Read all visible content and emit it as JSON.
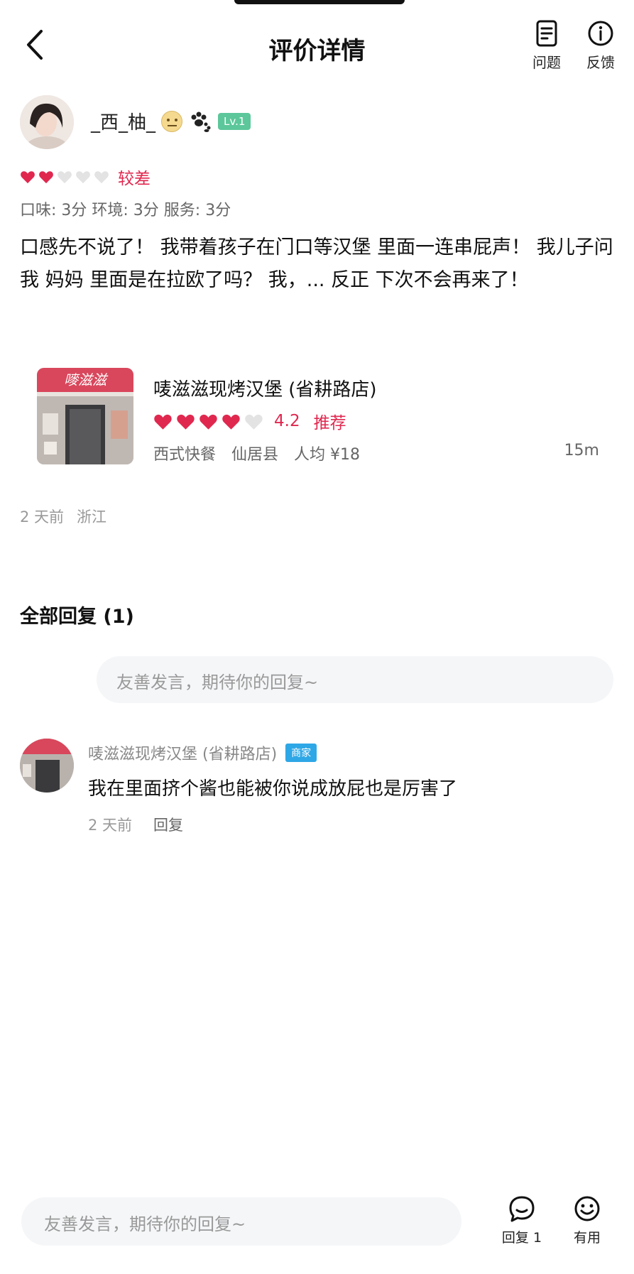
{
  "header": {
    "title": "评价详情",
    "question_label": "问题",
    "feedback_label": "反馈"
  },
  "user": {
    "name": "_西_柚_",
    "level": "Lv.1"
  },
  "rating": {
    "hearts_filled": 2,
    "hearts_total": 5,
    "label": "较差",
    "scores": "口味: 3分  环境: 3分  服务: 3分"
  },
  "review": {
    "text": "口感先不说了！ 我带着孩子在门口等汉堡  里面一连串屁声！ 我儿子问我 妈妈 里面是在拉欧了吗？ 我，... 反正 下次不会再来了！"
  },
  "shop": {
    "sign_text": "嘜滋滋",
    "name": "唛滋滋现烤汉堡 (省耕路店)",
    "hearts_filled": 4,
    "hearts_total": 5,
    "score": "4.2",
    "recommend": "推荐",
    "category": "西式快餐",
    "area": "仙居县",
    "avg_price": "人均 ¥18",
    "distance": "15m"
  },
  "post_meta": {
    "time": "2 天前",
    "location": "浙江"
  },
  "replies": {
    "title": "全部回复 (1)",
    "input_placeholder": "友善发言，期待你的回复~",
    "items": [
      {
        "name": "唛滋滋现烤汉堡 (省耕路店)",
        "badge": "商家",
        "text": "我在里面挤个酱也能被你说成放屁也是厉害了",
        "time": "2 天前",
        "reply_label": "回复"
      }
    ]
  },
  "bottom_bar": {
    "input_placeholder": "友善发言，期待你的回复~",
    "reply_label": "回复 1",
    "useful_label": "有用"
  },
  "colors": {
    "accent_red": "#e0284f",
    "level_green": "#5cc79a",
    "merchant_blue": "#2ea7e6",
    "empty_heart": "#e3e3e3"
  },
  "icons": [
    "back-arrow-icon",
    "question-doc-icon",
    "info-icon",
    "heart-icon",
    "neutral-face-emoji-icon",
    "paw-icon",
    "comment-bubble-icon",
    "smile-icon"
  ]
}
